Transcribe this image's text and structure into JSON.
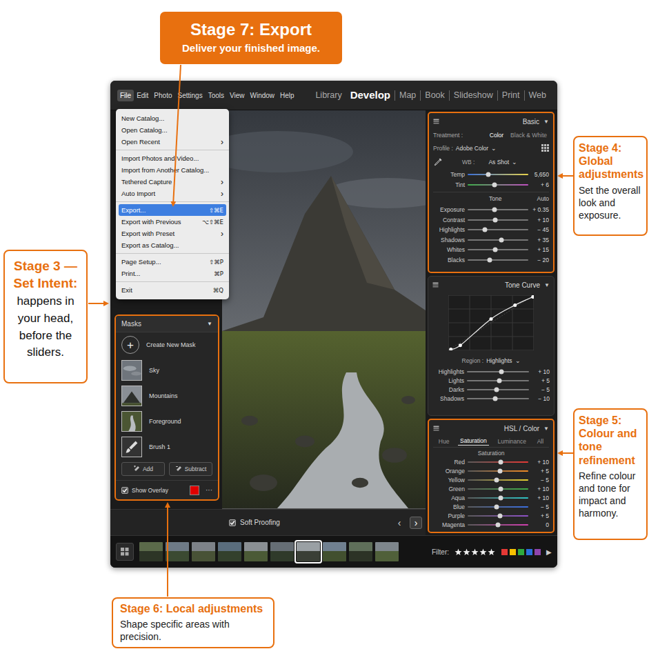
{
  "callouts": [
    {
      "title": "Stage 7: Export",
      "body": "Deliver your finished image.",
      "kind": "filled"
    },
    {
      "title": "Stage 4: Global adjustments",
      "body": "Set the overall look and exposure.",
      "kind": "outline"
    },
    {
      "title": "Stage 3 — Set Intent:",
      "body": "happens in your head, before the sliders.",
      "kind": "centered"
    },
    {
      "title": "Stage 5: Colour and tone refinement",
      "body": "Refine colour and tone for impact and harmony.",
      "kind": "outline"
    },
    {
      "title": "Stage 6: Local adjustments",
      "body": "Shape specific areas with precision.",
      "kind": "wide"
    }
  ],
  "menu_bar": {
    "items": [
      {
        "label": "File",
        "selected": true
      },
      {
        "label": "Edit",
        "selected": false
      },
      {
        "label": "Photo",
        "selected": false
      },
      {
        "label": "Settings",
        "selected": false
      },
      {
        "label": "Tools",
        "selected": false
      },
      {
        "label": "View",
        "selected": false
      },
      {
        "label": "Window",
        "selected": false
      },
      {
        "label": "Help",
        "selected": false
      }
    ]
  },
  "modules": [
    {
      "label": "Library",
      "selected": false
    },
    {
      "label": "Develop",
      "selected": true
    },
    {
      "label": "Map",
      "selected": false
    },
    {
      "label": "Book",
      "selected": false
    },
    {
      "label": "Slideshow",
      "selected": false
    },
    {
      "label": "Print",
      "selected": false
    },
    {
      "label": "Web",
      "selected": false
    }
  ],
  "file_menu": {
    "groups": [
      [
        {
          "label": "New Catalog...",
          "trailing": "",
          "selected": false
        },
        {
          "label": "Open Catalog...",
          "trailing": "",
          "selected": false
        },
        {
          "label": "Open Recent",
          "trailing": "›",
          "selected": false
        }
      ],
      [
        {
          "label": "Import Photos and Video...",
          "trailing": "",
          "selected": false
        },
        {
          "label": "Import from Another Catalog...",
          "trailing": "",
          "selected": false
        },
        {
          "label": "Tethered Capture",
          "trailing": "›",
          "selected": false
        },
        {
          "label": "Auto Import",
          "trailing": "›",
          "selected": false
        }
      ],
      [
        {
          "label": "Export...",
          "trailing": "⇧⌘E",
          "selected": true
        },
        {
          "label": "Export with Previous",
          "trailing": "⌥⇧⌘E",
          "selected": false
        },
        {
          "label": "Export with Preset",
          "trailing": "›",
          "selected": false
        },
        {
          "label": "Export as Catalog...",
          "trailing": "",
          "selected": false
        }
      ],
      [
        {
          "label": "Page Setup...",
          "trailing": "⇧⌘P",
          "selected": false
        },
        {
          "label": "Print...",
          "trailing": "⌘P",
          "selected": false
        }
      ],
      [
        {
          "label": "Exit",
          "trailing": "⌘Q",
          "selected": false
        }
      ]
    ]
  },
  "basic": {
    "title": "Basic",
    "toggle": "▼",
    "treatment": {
      "label": "Treatment :",
      "options": [
        {
          "label": "Color",
          "selected": true
        },
        {
          "label": "Black & White",
          "selected": false
        }
      ]
    },
    "profile": {
      "label": "Profile :",
      "value": "Adobe Color",
      "caret": "⌄"
    },
    "wb": {
      "label": "WB :",
      "value": "As Shot",
      "caret": "⌄"
    },
    "wb_sliders": [
      {
        "label": "Temp",
        "reading": "5,650",
        "level": 0.34,
        "kind": "temp"
      },
      {
        "label": "Tint",
        "reading": "+ 6",
        "level": 0.44,
        "kind": "tint"
      }
    ],
    "tone": {
      "label": "Tone",
      "auto": "Auto"
    },
    "tone_sliders": [
      {
        "label": "Exposure",
        "reading": "+ 0.35",
        "level": 0.44
      },
      {
        "label": "Contrast",
        "reading": "+ 10",
        "level": 0.46
      },
      {
        "label": "Highlights",
        "reading": "− 45",
        "level": 0.28
      },
      {
        "label": "Shadows",
        "reading": "+ 35",
        "level": 0.56
      },
      {
        "label": "Whites",
        "reading": "+ 15",
        "level": 0.46
      },
      {
        "label": "Blacks",
        "reading": "− 20",
        "level": 0.36
      }
    ]
  },
  "tone_curve": {
    "title": "Tone Curve",
    "toggle": "▼",
    "points": [
      [
        0.03,
        0.02
      ],
      [
        0.14,
        0.09
      ],
      [
        0.5,
        0.57
      ],
      [
        0.78,
        0.82
      ],
      [
        0.99,
        0.97
      ]
    ],
    "region": {
      "label": "Region :",
      "value": "Highlights",
      "caret": "⌄"
    },
    "sliders": [
      {
        "label": "Highlights",
        "reading": "+ 10",
        "level": 0.55
      },
      {
        "label": "Lights",
        "reading": "+ 5",
        "level": 0.52
      },
      {
        "label": "Darks",
        "reading": "− 5",
        "level": 0.48
      },
      {
        "label": "Shadows",
        "reading": "− 10",
        "level": 0.45
      }
    ]
  },
  "hsl": {
    "title": "HSL / Color",
    "toggle": "▼",
    "tabs": [
      {
        "label": "Hue",
        "selected": false
      },
      {
        "label": "Saturation",
        "selected": true
      },
      {
        "label": "Luminance",
        "selected": false
      },
      {
        "label": "All",
        "selected": false
      }
    ],
    "section": "Saturation",
    "sliders": [
      {
        "label": "Red",
        "reading": "+ 10",
        "level": 0.55,
        "color": "#e53935"
      },
      {
        "label": "Orange",
        "reading": "+ 5",
        "level": 0.53,
        "color": "#f08a24"
      },
      {
        "label": "Yellow",
        "reading": "− 5",
        "level": 0.48,
        "color": "#e8d130"
      },
      {
        "label": "Green",
        "reading": "+ 10",
        "level": 0.55,
        "color": "#3fae49"
      },
      {
        "label": "Aqua",
        "reading": "+ 10",
        "level": 0.55,
        "color": "#2ec4c4"
      },
      {
        "label": "Blue",
        "reading": "− 5",
        "level": 0.48,
        "color": "#3b6fe0"
      },
      {
        "label": "Purple",
        "reading": "+ 5",
        "level": 0.53,
        "color": "#8e52c9"
      },
      {
        "label": "Magenta",
        "reading": "0",
        "level": 0.5,
        "color": "#d13fb0"
      }
    ]
  },
  "masks": {
    "title": "Masks",
    "toggle": "▼",
    "create": {
      "icon": "+",
      "label": "Create New Mask"
    },
    "items": [
      {
        "label": "Sky",
        "kind": "sky"
      },
      {
        "label": "Mountains",
        "kind": "mountains"
      },
      {
        "label": "Foreground",
        "kind": "foreground"
      },
      {
        "label": "Brush 1",
        "kind": "brush"
      }
    ],
    "buttons": [
      {
        "label": "Add"
      },
      {
        "label": "Subtract"
      }
    ],
    "overlay": {
      "label": "Show Overlay",
      "checked": true,
      "color": "#e00000"
    },
    "more": "···"
  },
  "soft_proofing": {
    "label": "Soft Proofing",
    "checked": true,
    "nav": [
      {
        "glyph": "‹",
        "selected": false
      },
      {
        "glyph": "›",
        "selected": true
      }
    ]
  },
  "filmstrip": {
    "thumbs": [
      {
        "selected": false
      },
      {
        "selected": false
      },
      {
        "selected": false
      },
      {
        "selected": false
      },
      {
        "selected": false
      },
      {
        "selected": false
      },
      {
        "selected": true
      },
      {
        "selected": false
      },
      {
        "selected": false
      },
      {
        "selected": false
      }
    ],
    "filter": {
      "label": "Filter:",
      "stars": 5,
      "labels": [
        {
          "color": "#e53935"
        },
        {
          "color": "#f6c000"
        },
        {
          "color": "#2eaa3f"
        },
        {
          "color": "#2a6fdb"
        },
        {
          "color": "#8e44ad"
        }
      ],
      "next": "▶"
    }
  }
}
